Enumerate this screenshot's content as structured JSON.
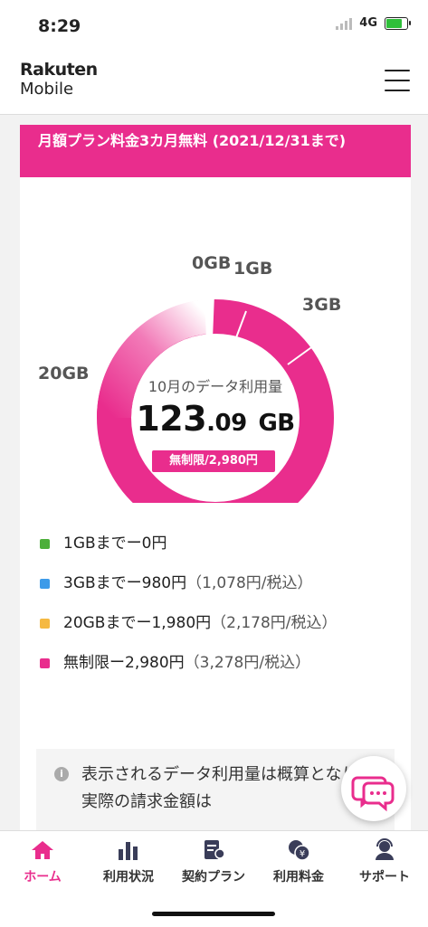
{
  "status_bar": {
    "time": "8:29",
    "network": "4G"
  },
  "header": {
    "logo_line1": "Rakuten",
    "logo_line2": "Mobile"
  },
  "banner": {
    "text": "月額プラン料金3カ月無料 (2021/12/31まで)"
  },
  "usage": {
    "title": "10月のデータ利用量",
    "value_int": "123",
    "value_dec": ".09",
    "unit": "GB",
    "plan_badge": "無制限/2,980円",
    "ticks": {
      "t0": "0GB",
      "t1": "1GB",
      "t3": "3GB",
      "t20": "20GB"
    },
    "colors": {
      "accent": "#e92d8d",
      "fade": "#fbe3f0"
    }
  },
  "legend": [
    {
      "text": "1GBまでー0円",
      "extra": "",
      "color": "#4caf3a"
    },
    {
      "text": "3GBまでー980円",
      "extra": "（1,078円/税込）",
      "color": "#3d9be9"
    },
    {
      "text": "20GBまでー1,980円",
      "extra": "（2,178円/税込）",
      "color": "#f5b942"
    },
    {
      "text": "無制限ー2,980円",
      "extra": "（3,278円/税込）",
      "color": "#e92d8d"
    }
  ],
  "note": {
    "text": "表示されるデータ利用量は概算となり、実際の請求金額は"
  },
  "nav": {
    "home": "ホーム",
    "usage": "利用状況",
    "plan": "契約プラン",
    "fee": "利用料金",
    "support": "サポート"
  }
}
